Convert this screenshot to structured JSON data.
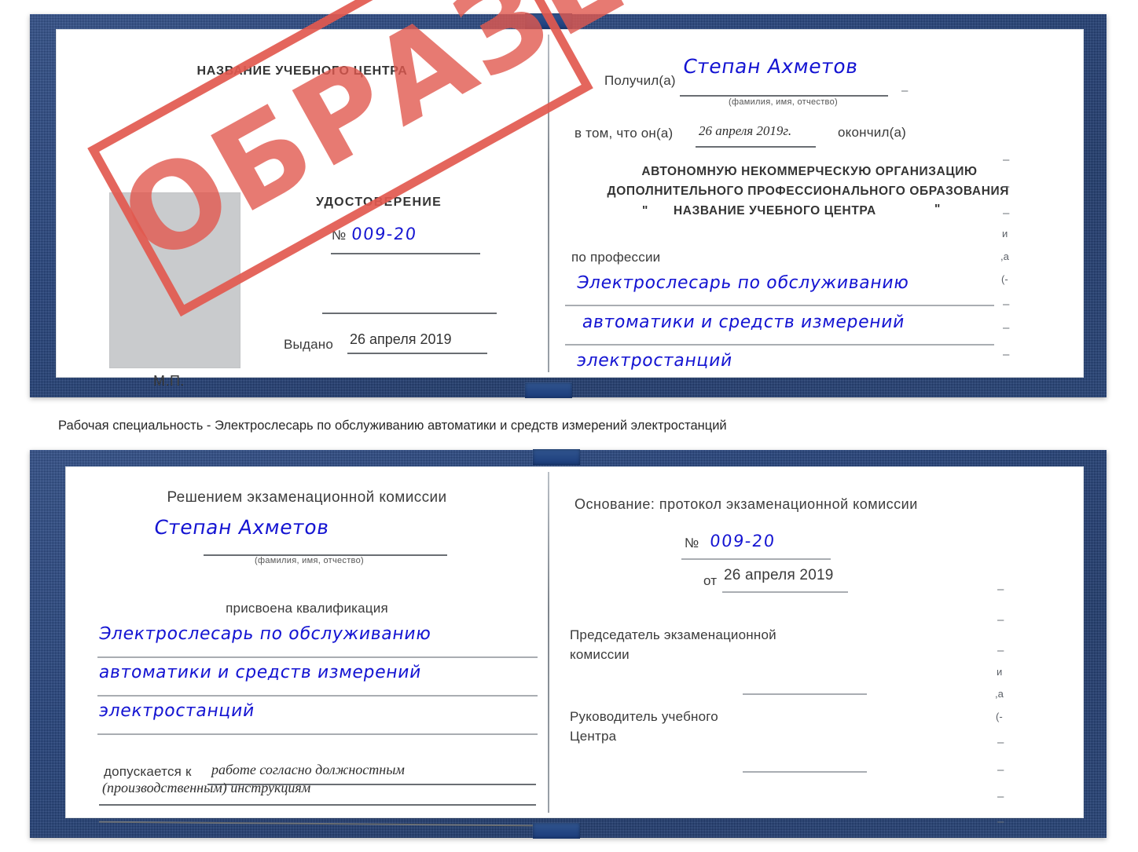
{
  "caption": "Рабочая специальность - Электрослесарь по обслуживанию автоматики и средств измерений электростанций",
  "stamp": {
    "text": "ОБРАЗЕЦ",
    "color": "#e2594f"
  },
  "colors": {
    "cover_blue": "#1d3f80",
    "handwriting_blue": "#1414d2",
    "photo_placeholder_gray": "#c9cbcd",
    "rule_gray": "#8b8f94"
  },
  "certificate_top": {
    "left_page": {
      "center_title": "НАЗВАНИЕ УЧЕБНОГО ЦЕНТРА",
      "doc_type": "УДОСТОВЕРЕНИЕ",
      "number_label": "№",
      "number_value": "009-20",
      "issued_label": "Выдано",
      "issued_value": "26 апреля 2019",
      "seal_label": "М.П.",
      "photo_placeholder": "photo-placeholder"
    },
    "right_page": {
      "received_label": "Получил(а)",
      "received_value": "Степан Ахметов",
      "fio_hint": "(фамилия, имя, отчество)",
      "in_that_label": "в том, что он(а)",
      "completion_date": "26 апреля 2019г.",
      "finished_label": "окончил(а)",
      "org_line_1": "АВТОНОМНУЮ НЕКОММЕРЧЕСКУЮ ОРГАНИЗАЦИЮ",
      "org_line_2": "ДОПОЛНИТЕЛЬНОГО ПРОФЕССИОНАЛЬНОГО ОБРАЗОВАНИЯ",
      "org_quote_open": "\"",
      "org_line_3": "НАЗВАНИЕ УЧЕБНОГО ЦЕНТРА",
      "org_quote_close": "\"",
      "profession_label": "по профессии",
      "profession_line_1": "Электрослесарь по обслуживанию",
      "profession_line_2": "автоматики и средств измерений",
      "profession_line_3": "электростанций",
      "bleed_marks": [
        "–",
        "–",
        "–",
        "и",
        "а",
        "(-",
        "–",
        "–",
        "–"
      ]
    }
  },
  "certificate_bottom": {
    "left_page": {
      "heading": "Решением экзаменационной комиссии",
      "name_value": "Степан Ахметов",
      "fio_hint": "(фамилия, имя, отчество)",
      "qualification_label": "присвоена квалификация",
      "qualification_line_1": "Электрослесарь по обслуживанию",
      "qualification_line_2": "автоматики и средств измерений",
      "qualification_line_3": "электростанций",
      "allowed_label": "допускается к",
      "allowed_value_1": "работе согласно должностным",
      "allowed_value_2": "(производственным) инструкциям"
    },
    "right_page": {
      "basis_label": "Основание: протокол экзаменационной комиссии",
      "number_label": "№",
      "number_value": "009-20",
      "from_label": "от",
      "from_value": "26 апреля 2019",
      "chairman_line_1": "Председатель экзаменационной",
      "chairman_line_2": "комиссии",
      "head_line_1": "Руководитель учебного",
      "head_line_2": "Центра",
      "bleed_marks": [
        "–",
        "–",
        "–",
        "и",
        "а",
        "(-",
        "–",
        "–",
        "–",
        "–"
      ]
    }
  }
}
